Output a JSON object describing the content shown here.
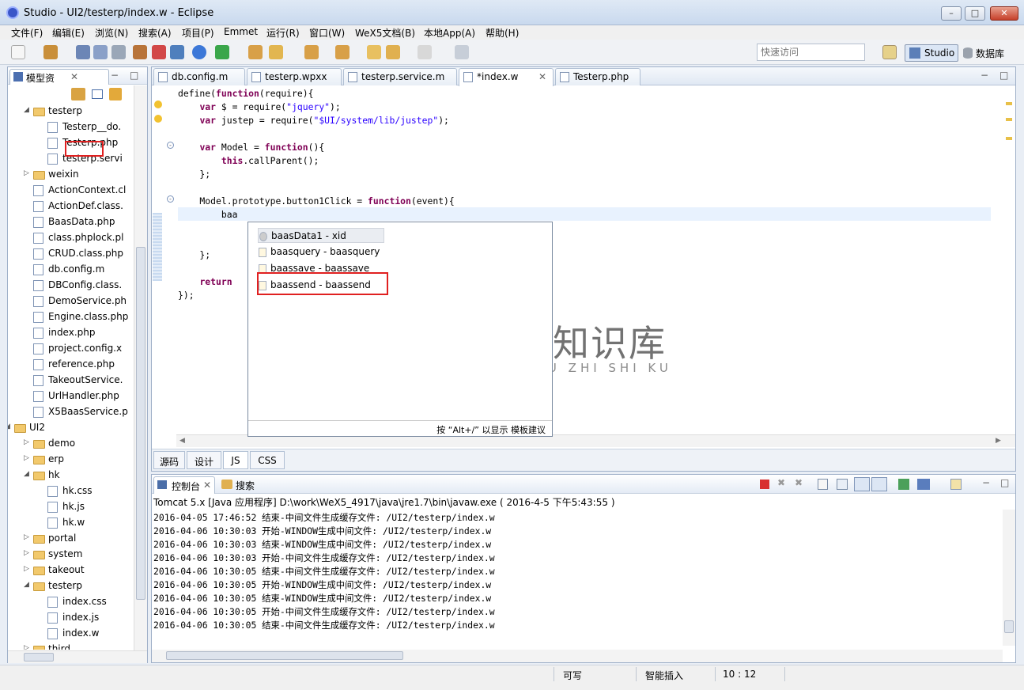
{
  "window": {
    "title": "Studio - UI2/testerp/index.w - Eclipse",
    "controls": [
      "minimize",
      "maximize",
      "close"
    ]
  },
  "menu": [
    "文件(F)",
    "编辑(E)",
    "浏览(N)",
    "搜索(A)",
    "项目(P)",
    "Emmet",
    "运行(R)",
    "窗口(W)",
    "WeX5文档(B)",
    "本地App(A)",
    "帮助(H)"
  ],
  "toolbar": {
    "quick_access": "快速访问",
    "perspectives": [
      "Studio",
      "数据库"
    ]
  },
  "explorer": {
    "tab_label": "模型资",
    "items": [
      {
        "label": "testerp",
        "type": "folder",
        "depth": 1,
        "state": "open"
      },
      {
        "label": "Testerp__do.",
        "type": "file",
        "depth": 2
      },
      {
        "label": "Testerp.php",
        "type": "file",
        "depth": 2
      },
      {
        "label": "testerp.servi",
        "type": "file",
        "depth": 2
      },
      {
        "label": "weixin",
        "type": "folder",
        "depth": 1,
        "state": "closed"
      },
      {
        "label": "ActionContext.cl",
        "type": "file",
        "depth": 1
      },
      {
        "label": "ActionDef.class.",
        "type": "file",
        "depth": 1
      },
      {
        "label": "BaasData.php",
        "type": "file",
        "depth": 1
      },
      {
        "label": "class.phplock.pl",
        "type": "file",
        "depth": 1
      },
      {
        "label": "CRUD.class.php",
        "type": "file",
        "depth": 1
      },
      {
        "label": "db.config.m",
        "type": "file",
        "depth": 1
      },
      {
        "label": "DBConfig.class.",
        "type": "file",
        "depth": 1
      },
      {
        "label": "DemoService.ph",
        "type": "file",
        "depth": 1
      },
      {
        "label": "Engine.class.php",
        "type": "file",
        "depth": 1
      },
      {
        "label": "index.php",
        "type": "file",
        "depth": 1
      },
      {
        "label": "project.config.x",
        "type": "file",
        "depth": 1
      },
      {
        "label": "reference.php",
        "type": "file",
        "depth": 1
      },
      {
        "label": "TakeoutService.",
        "type": "file",
        "depth": 1
      },
      {
        "label": "UrlHandler.php",
        "type": "file",
        "depth": 1
      },
      {
        "label": "X5BaasService.p",
        "type": "file",
        "depth": 1
      },
      {
        "label": "UI2",
        "type": "folder",
        "depth": 0,
        "state": "open"
      },
      {
        "label": "demo",
        "type": "folder",
        "depth": 1,
        "state": "closed"
      },
      {
        "label": "erp",
        "type": "folder",
        "depth": 1,
        "state": "closed"
      },
      {
        "label": "hk",
        "type": "folder",
        "depth": 1,
        "state": "open"
      },
      {
        "label": "hk.css",
        "type": "file",
        "depth": 2
      },
      {
        "label": "hk.js",
        "type": "file",
        "depth": 2
      },
      {
        "label": "hk.w",
        "type": "file",
        "depth": 2
      },
      {
        "label": "portal",
        "type": "folder",
        "depth": 1,
        "state": "closed"
      },
      {
        "label": "system",
        "type": "folder",
        "depth": 1,
        "state": "closed"
      },
      {
        "label": "takeout",
        "type": "folder",
        "depth": 1,
        "state": "closed"
      },
      {
        "label": "testerp",
        "type": "folder",
        "depth": 1,
        "state": "open"
      },
      {
        "label": "index.css",
        "type": "file",
        "depth": 2
      },
      {
        "label": "index.js",
        "type": "file",
        "depth": 2
      },
      {
        "label": "index.w",
        "type": "file",
        "depth": 2
      },
      {
        "label": "third",
        "type": "folder",
        "depth": 1,
        "state": "closed"
      }
    ]
  },
  "editor": {
    "tabs": [
      "db.config.m",
      "testerp.wpxx",
      "testerp.service.m",
      "*index.w",
      "Testerp.php"
    ],
    "active_tab": "*index.w",
    "code_lines": [
      "define(function(require){",
      "    var $ = require(\"jquery\");",
      "    var justep = require(\"$UI/system/lib/justep\");",
      "",
      "    var Model = function(){",
      "        this.callParent();",
      "    };",
      "",
      "    Model.prototype.button1Click = function(event){",
      "        baa",
      "",
      "",
      "    };",
      "",
      "    return",
      "});"
    ],
    "autocomplete": {
      "items": [
        "baasData1 - xid",
        "baasquery - baasquery",
        "baassave - baassave",
        "baassend - baassend"
      ],
      "hint": "按 “Alt+/” 以显示 模板建议"
    },
    "bottom_tabs": [
      "源码",
      "设计",
      "JS",
      "CSS"
    ],
    "active_bottom_tab": "JS"
  },
  "watermark": {
    "title": "小牛知识库",
    "subtitle": "XIAO NIU ZHI SHI KU"
  },
  "console": {
    "tabs": [
      "控制台",
      "搜索"
    ],
    "info": "Tomcat 5.x [Java 应用程序] D:\\work\\WeX5_4917\\java\\jre1.7\\bin\\javaw.exe ( 2016-4-5 下午5:43:55 )",
    "lines": [
      "2016-04-05 17:46:52 结束-中间文件生成缓存文件: /UI2/testerp/index.w",
      "2016-04-06 10:30:03 开始-WINDOW生成中间文件: /UI2/testerp/index.w",
      "2016-04-06 10:30:03 结束-WINDOW生成中间文件: /UI2/testerp/index.w",
      "2016-04-06 10:30:03 开始-中间文件生成缓存文件: /UI2/testerp/index.w",
      "2016-04-06 10:30:05 结束-中间文件生成缓存文件: /UI2/testerp/index.w",
      "2016-04-06 10:30:05 开始-WINDOW生成中间文件: /UI2/testerp/index.w",
      "2016-04-06 10:30:05 结束-WINDOW生成中间文件: /UI2/testerp/index.w",
      "2016-04-06 10:30:05 开始-中间文件生成缓存文件: /UI2/testerp/index.w",
      "2016-04-06 10:30:05 结束-中间文件生成缓存文件: /UI2/testerp/index.w"
    ]
  },
  "status": {
    "writable": "可写",
    "insert_mode": "智能插入",
    "position": "10 : 12"
  },
  "colors": {
    "keyword": "#7f0055",
    "string": "#2a00ff",
    "highlight_box": "#e02020"
  }
}
